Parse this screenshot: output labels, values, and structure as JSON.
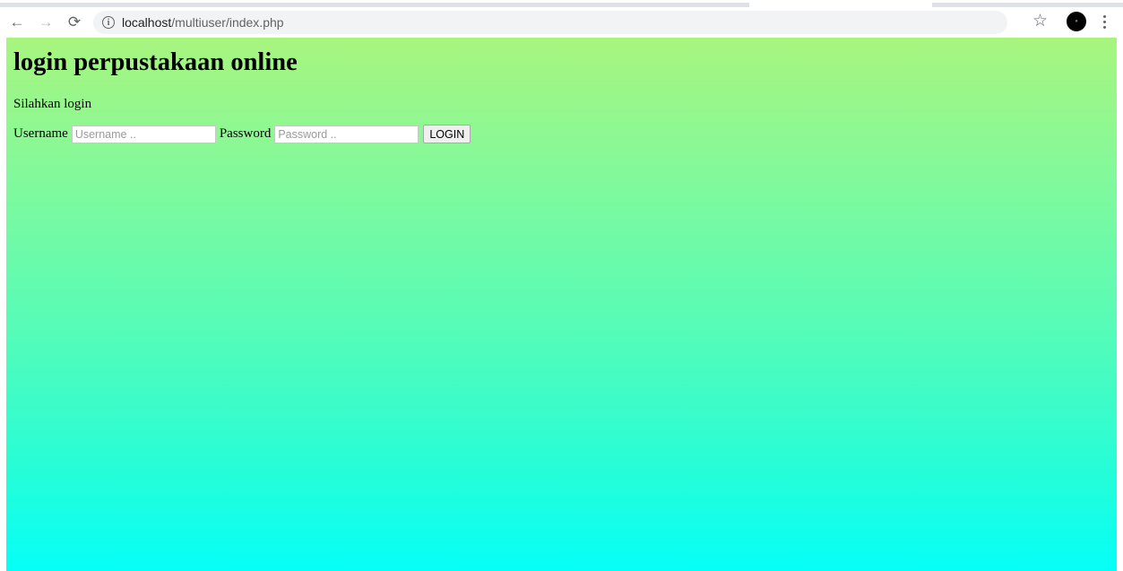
{
  "browser": {
    "url_host": "localhost",
    "url_path": "/multiuser/index.php",
    "icons": {
      "back": "arrow-left-icon",
      "forward": "arrow-right-icon",
      "reload": "reload-icon",
      "site_info": "info-icon",
      "bookmark": "star-icon",
      "profile": "avatar",
      "menu": "kebab-menu-icon"
    }
  },
  "page": {
    "title": "login perpustakaan online",
    "subtitle": "Silahkan login",
    "form": {
      "username_label": "Username",
      "username_placeholder": "Username ..",
      "password_label": "Password",
      "password_placeholder": "Password ..",
      "submit_label": "LOGIN"
    }
  },
  "colors": {
    "gradient_top": "#a8f57e",
    "gradient_bottom": "#05fff7"
  }
}
